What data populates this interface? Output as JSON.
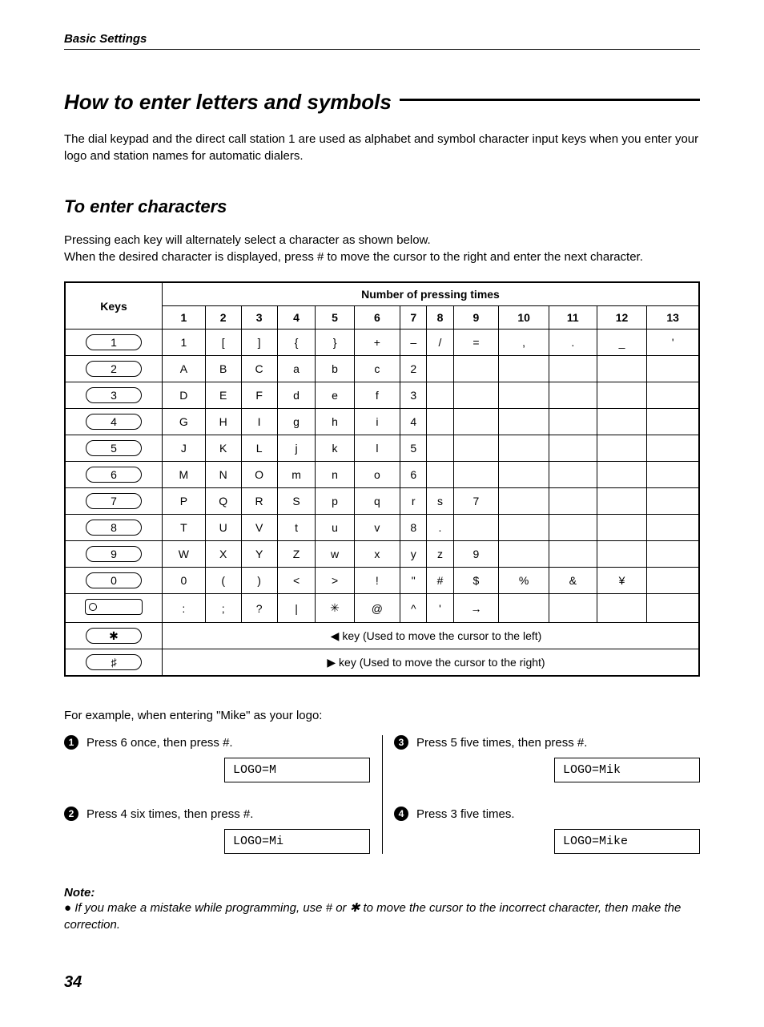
{
  "header": {
    "section": "Basic Settings"
  },
  "title": "How to enter letters and symbols",
  "intro": "The dial keypad and the direct call station 1 are used as alphabet and symbol character input keys when you enter your logo and station names for automatic dialers.",
  "subheading": "To enter characters",
  "desc": "Pressing each key will alternately select a character as shown below.\nWhen the desired character is displayed, press # to move the cursor to the right and enter the next character.",
  "table": {
    "keys_header": "Keys",
    "presses_header": "Number of pressing times",
    "cols": [
      "1",
      "2",
      "3",
      "4",
      "5",
      "6",
      "7",
      "8",
      "9",
      "10",
      "11",
      "12",
      "13"
    ],
    "rows": [
      {
        "key": "1",
        "vals": [
          "1",
          "[",
          "]",
          "{",
          "}",
          "+",
          "–",
          "/",
          "=",
          ",",
          ".",
          "_",
          "'"
        ]
      },
      {
        "key": "2",
        "vals": [
          "A",
          "B",
          "C",
          "a",
          "b",
          "c",
          "2",
          "",
          "",
          "",
          "",
          "",
          ""
        ]
      },
      {
        "key": "3",
        "vals": [
          "D",
          "E",
          "F",
          "d",
          "e",
          "f",
          "3",
          "",
          "",
          "",
          "",
          "",
          ""
        ]
      },
      {
        "key": "4",
        "vals": [
          "G",
          "H",
          "I",
          "g",
          "h",
          "i",
          "4",
          "",
          "",
          "",
          "",
          "",
          ""
        ]
      },
      {
        "key": "5",
        "vals": [
          "J",
          "K",
          "L",
          "j",
          "k",
          "l",
          "5",
          "",
          "",
          "",
          "",
          "",
          ""
        ]
      },
      {
        "key": "6",
        "vals": [
          "M",
          "N",
          "O",
          "m",
          "n",
          "o",
          "6",
          "",
          "",
          "",
          "",
          "",
          ""
        ]
      },
      {
        "key": "7",
        "vals": [
          "P",
          "Q",
          "R",
          "S",
          "p",
          "q",
          "r",
          "s",
          "7",
          "",
          "",
          "",
          ""
        ]
      },
      {
        "key": "8",
        "vals": [
          "T",
          "U",
          "V",
          "t",
          "u",
          "v",
          "8",
          ".",
          "",
          "",
          "",
          "",
          ""
        ]
      },
      {
        "key": "9",
        "vals": [
          "W",
          "X",
          "Y",
          "Z",
          "w",
          "x",
          "y",
          "z",
          "9",
          "",
          "",
          "",
          ""
        ]
      },
      {
        "key": "0",
        "vals": [
          "0",
          "(",
          ")",
          "<",
          ">",
          "!",
          "\"",
          "#",
          "$",
          "%",
          "&",
          "¥",
          ""
        ]
      },
      {
        "key": "direct1",
        "vals": [
          ":",
          ";",
          "?",
          "|",
          "✳",
          "@",
          "^",
          "'",
          "→",
          "",
          "",
          "",
          ""
        ]
      }
    ],
    "star_key": "✱",
    "star_note": "◀ key (Used to move the cursor to the left)",
    "hash_key": "♯",
    "hash_note": "▶ key (Used to move the cursor to the right)"
  },
  "example": {
    "lead": "For example, when entering \"Mike\" as your logo:",
    "steps": [
      {
        "n": "1",
        "text": "Press 6 once, then press #.",
        "display": "LOGO=M"
      },
      {
        "n": "2",
        "text": "Press 4 six times, then press #.",
        "display": "LOGO=Mi"
      },
      {
        "n": "3",
        "text": "Press 5 five times, then press #.",
        "display": "LOGO=Mik"
      },
      {
        "n": "4",
        "text": "Press 3 five times.",
        "display": "LOGO=Mike"
      }
    ]
  },
  "note": {
    "label": "Note:",
    "body": "If you make a mistake while programming, use # or ✱ to move the cursor to the incorrect character, then make the correction."
  },
  "page_number": "34"
}
